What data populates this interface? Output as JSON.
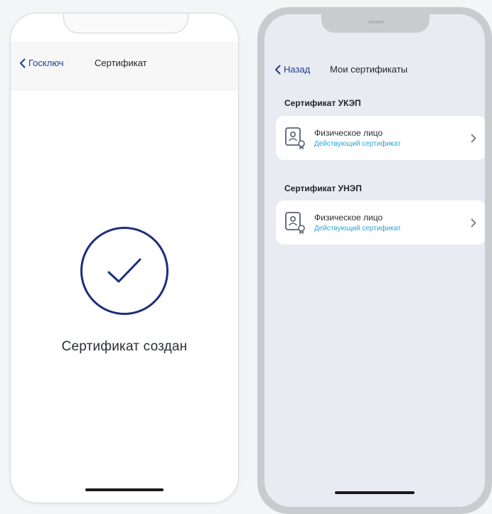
{
  "left_screen": {
    "back_label": "Госключ",
    "title": "Сертификат",
    "message": "Сертификат создан"
  },
  "right_screen": {
    "back_label": "Назад",
    "title": "Мои сертификаты",
    "sections": [
      {
        "title": "Сертификат УКЭП",
        "card": {
          "name": "Физическое лицо",
          "status": "Действующий сертификат"
        }
      },
      {
        "title": "Сертификат УНЭП",
        "card": {
          "name": "Физическое лицо",
          "status": "Действующий сертификат"
        }
      }
    ]
  },
  "icons": {
    "back": "chevron-left-icon",
    "success": "checkmark-circle-icon",
    "certificate": "certificate-icon",
    "forward": "chevron-right-icon"
  },
  "colors": {
    "primary": "#1c3f95",
    "status": "#2aa3d8",
    "check": "#1c2f7a",
    "right_bg": "#e9ebf2"
  }
}
